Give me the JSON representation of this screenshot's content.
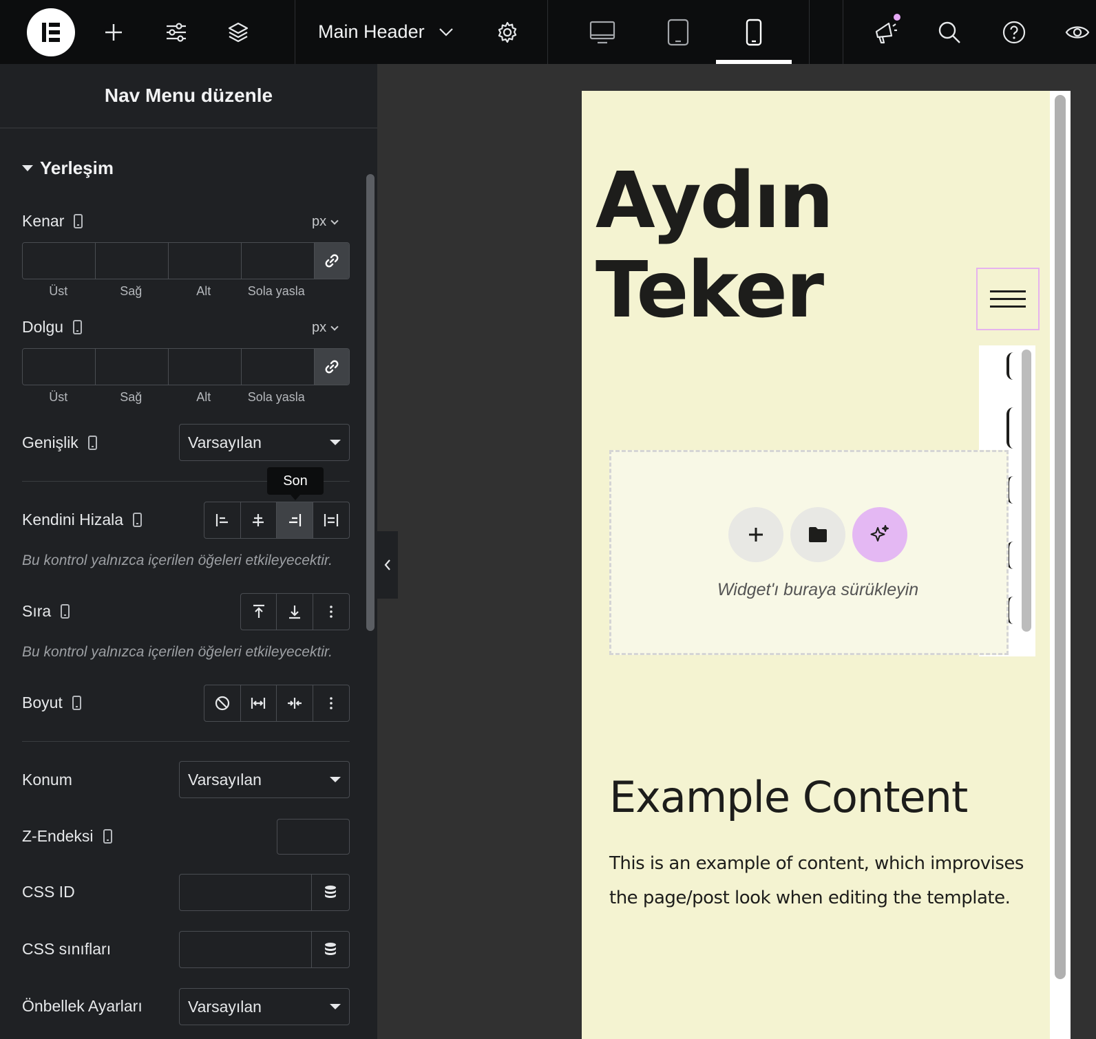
{
  "topbar": {
    "document_title": "Main Header",
    "icons": [
      "elementor-logo-icon",
      "plus-icon",
      "sliders-icon",
      "layers-icon",
      "chevron-down-icon",
      "gear-icon",
      "desktop-icon",
      "tablet-icon",
      "mobile-icon",
      "megaphone-icon",
      "search-icon",
      "help-icon",
      "eye-icon"
    ],
    "active_device": "mobile",
    "notification_color": "#e6a8f5"
  },
  "panel": {
    "title": "Nav Menu düzenle",
    "section_title": "Yerleşim",
    "margin": {
      "label": "Kenar",
      "unit": "px",
      "sides": [
        "Üst",
        "Sağ",
        "Alt",
        "Sola yasla"
      ]
    },
    "padding": {
      "label": "Dolgu",
      "unit": "px",
      "sides": [
        "Üst",
        "Sağ",
        "Alt",
        "Sola yasla"
      ]
    },
    "width": {
      "label": "Genişlik",
      "value": "Varsayılan"
    },
    "align_self": {
      "label": "Kendini Hizala",
      "tooltip": "Son",
      "active_index": 2,
      "note": "Bu kontrol yalnızca içerilen öğeleri etkileyecektir."
    },
    "order": {
      "label": "Sıra",
      "note": "Bu kontrol yalnızca içerilen öğeleri etkileyecektir."
    },
    "size": {
      "label": "Boyut"
    },
    "position": {
      "label": "Konum",
      "value": "Varsayılan"
    },
    "z_index": {
      "label": "Z-Endeksi"
    },
    "css_id": {
      "label": "CSS ID"
    },
    "css_classes": {
      "label": "CSS sınıfları"
    },
    "cache": {
      "label": "Önbellek Ayarları",
      "value": "Varsayılan"
    }
  },
  "canvas": {
    "site_title": "Aydın Teker",
    "dropzone_text": "Widget'ı buraya sürükleyin",
    "content_title": "Example Content",
    "content_text": "This is an example of content, which improvises the page/post look when editing the template.",
    "page_bg": "#f4f3d1",
    "accent": "#e4b8f3"
  }
}
